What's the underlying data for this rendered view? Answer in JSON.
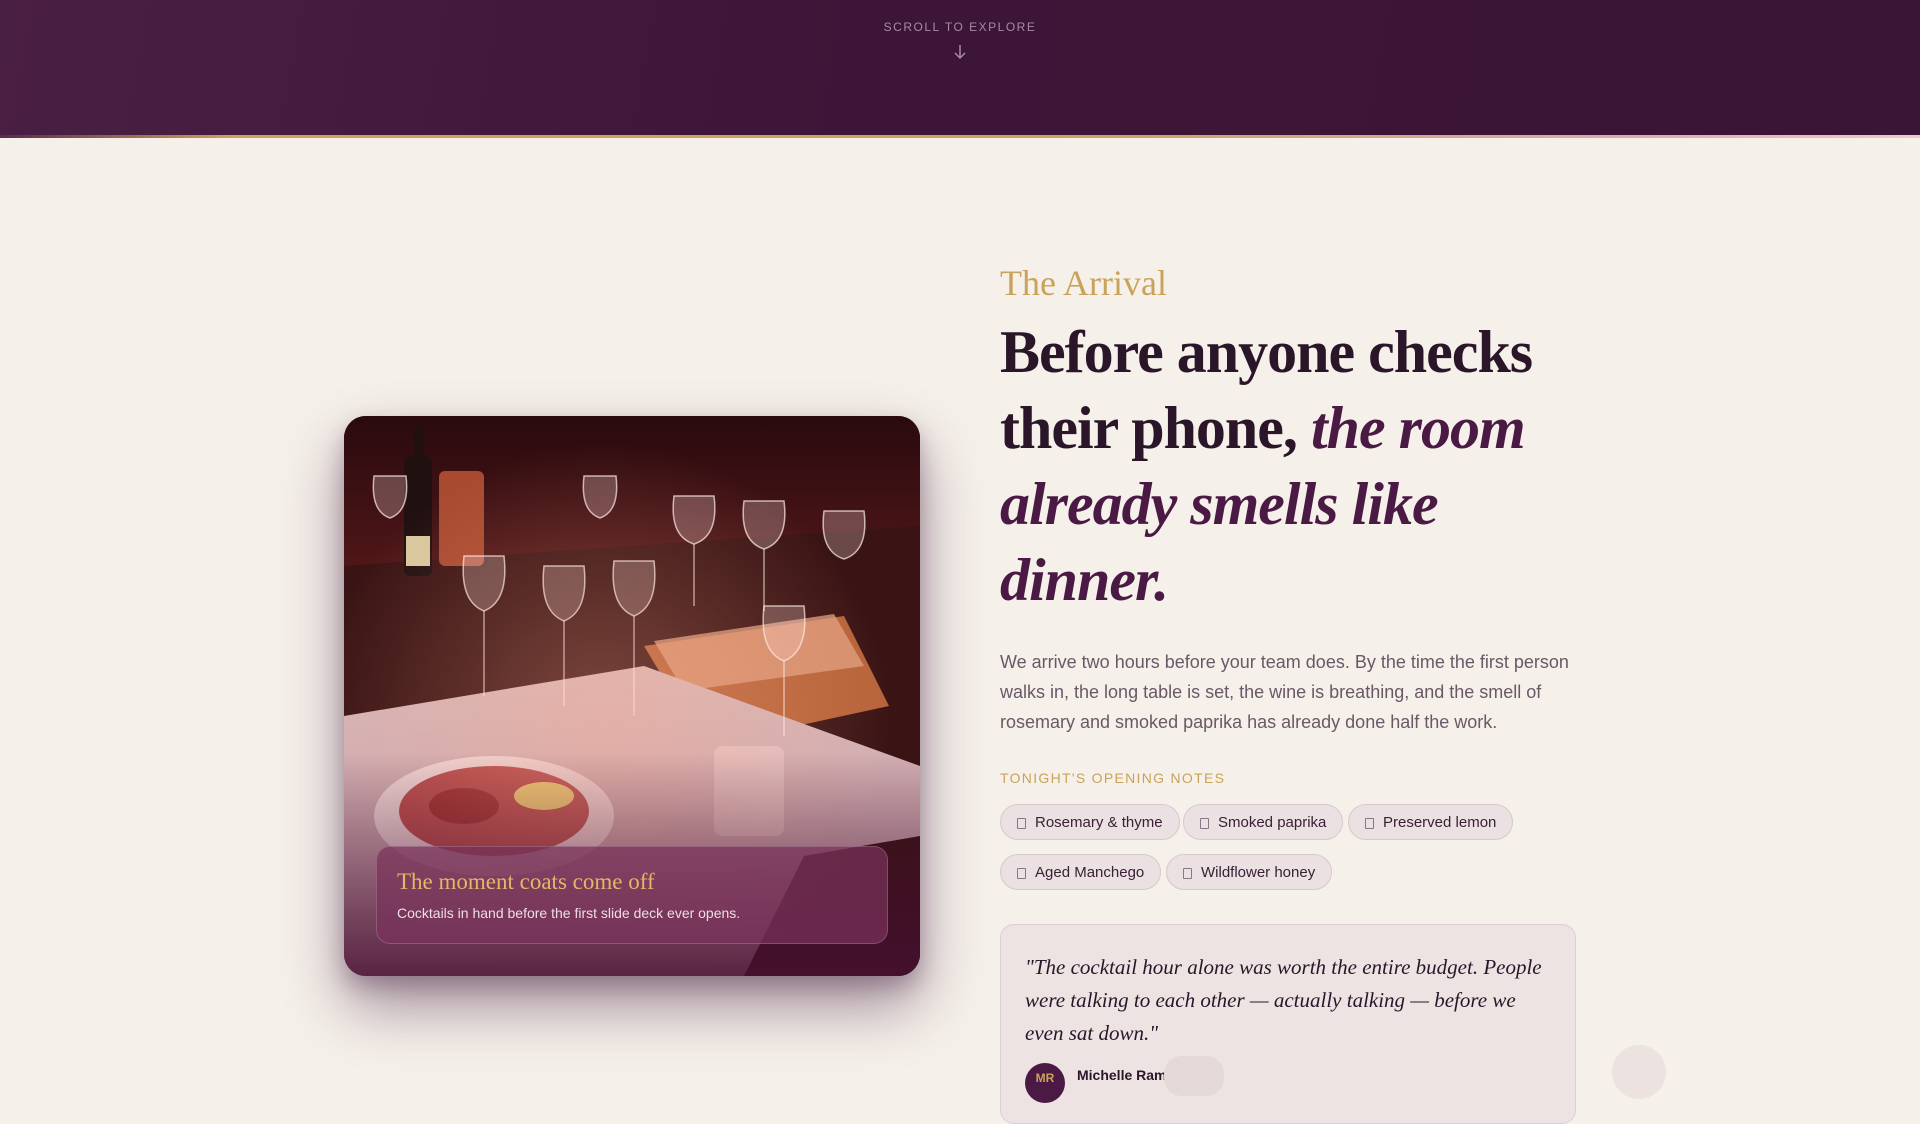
{
  "hero": {
    "scroll_hint": "SCROLL TO EXPLORE",
    "arrow_icon": "arrow-down-icon"
  },
  "photo": {
    "caption_title": "The moment coats come off",
    "caption_subtitle": "Cocktails in hand before the first slide deck ever opens."
  },
  "section": {
    "eyebrow": "The Arrival",
    "headline_plain": "Before anyone checks their phone, ",
    "headline_italic": "the room already smells like dinner.",
    "body": "We arrive two hours before your team does. By the time the first person walks in, the long table is set, the wine is breathing, and the smell of rosemary and smoked paprika has already done half the work.",
    "notes_label": "TONIGHT'S OPENING NOTES",
    "notes": [
      {
        "label": "Rosemary & thyme",
        "icon": "note-icon"
      },
      {
        "label": "Smoked paprika",
        "icon": "note-icon"
      },
      {
        "label": "Preserved lemon",
        "icon": "note-icon"
      },
      {
        "label": "Aged Manchego",
        "icon": "note-icon"
      },
      {
        "label": "Wildflower honey",
        "icon": "note-icon"
      }
    ]
  },
  "testimonial": {
    "quote": "\"The cocktail hour alone was worth the entire budget. People were talking to each other — actually talking — before we even sat down.\"",
    "initials": "MR",
    "name": "Michelle Ramirez"
  },
  "colors": {
    "plum": "#3d1538",
    "gold": "#c9a35a",
    "cream": "#f5f0ea",
    "ink": "#2a1628"
  }
}
